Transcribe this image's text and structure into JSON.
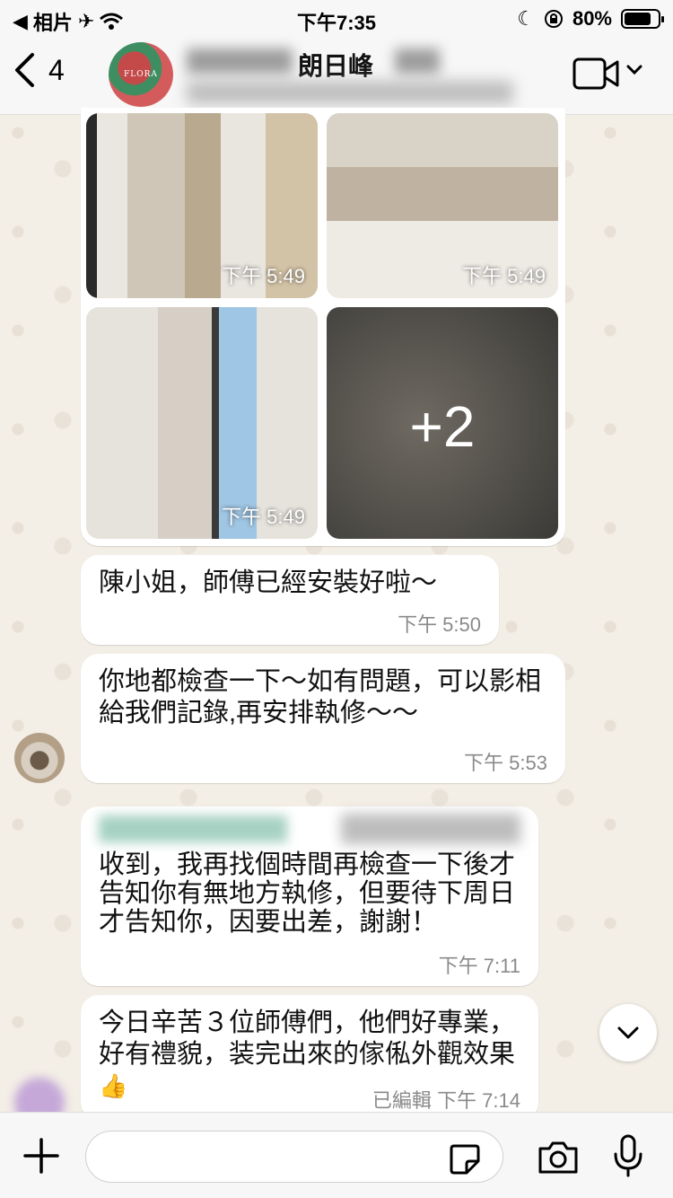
{
  "status_bar": {
    "back_app": "相片",
    "time": "下午7:35",
    "battery": "80%",
    "battery_level": 0.8
  },
  "header": {
    "back_count": "4",
    "chat_name": "朗日峰",
    "avatar_text": "FLORA"
  },
  "media_grid": {
    "tiles": [
      {
        "time": "下午 5:49"
      },
      {
        "time": "下午 5:49"
      },
      {
        "time": "下午 5:49"
      },
      {
        "more": "+2"
      }
    ]
  },
  "messages": [
    {
      "text": "陳小姐，師傅已經安裝好啦～",
      "time": "下午 5:50"
    },
    {
      "text": "你地都檢查一下～如有問題，可以影相給我們記錄,再安排執修～～",
      "time": "下午 5:53"
    },
    {
      "text": "收到，我再找個時間再檢查一下後才告知你有無地方執修，但要待下周日才告知你，因要出差，謝謝！",
      "time": "下午 7:11"
    },
    {
      "text": "今日辛苦３位師傅們，他們好專業，好有禮貌，装完出來的傢俬外觀效果",
      "emoji": "👍",
      "edited": "已編輯",
      "time": "下午 7:14"
    }
  ],
  "input": {
    "value": "",
    "placeholder": ""
  }
}
